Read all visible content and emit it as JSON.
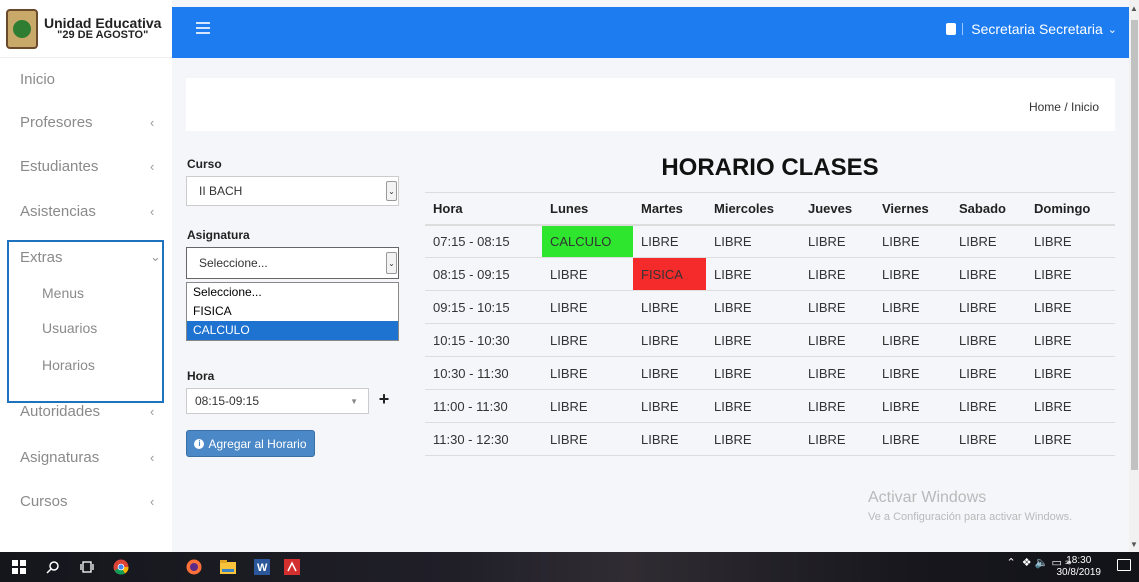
{
  "brand": {
    "line1": "Unidad Educativa",
    "line2": "\"29 DE AGOSTO\""
  },
  "sidebar": {
    "items": [
      {
        "label": "Inicio"
      },
      {
        "label": "Profesores"
      },
      {
        "label": "Estudiantes"
      },
      {
        "label": "Asistencias"
      },
      {
        "label": "Extras"
      },
      {
        "label": "Autoridades"
      },
      {
        "label": "Asignaturas"
      },
      {
        "label": "Cursos"
      }
    ],
    "subitems": [
      {
        "label": "Menus"
      },
      {
        "label": "Usuarios"
      },
      {
        "label": "Horarios"
      }
    ]
  },
  "topbar": {
    "user": "Secretaria Secretaria"
  },
  "breadcrumb": "Home / Inicio",
  "form": {
    "curso_label": "Curso",
    "curso_value": "II BACH",
    "asignatura_label": "Asignatura",
    "asignatura_value": "Seleccione...",
    "asignatura_options": [
      "Seleccione...",
      "FISICA",
      "CALCULO"
    ],
    "hora_label": "Hora",
    "hora_value": "08:15-09:15",
    "plus": "+",
    "add_button": "Agregar al Horario"
  },
  "schedule": {
    "title": "HORARIO CLASES",
    "headers": [
      "Hora",
      "Lunes",
      "Martes",
      "Miercoles",
      "Jueves",
      "Viernes",
      "Sabado",
      "Domingo"
    ],
    "rows": [
      [
        "07:15 - 08:15",
        "CALCULO",
        "LIBRE",
        "LIBRE",
        "LIBRE",
        "LIBRE",
        "LIBRE",
        "LIBRE"
      ],
      [
        "08:15 - 09:15",
        "LIBRE",
        "FISICA",
        "LIBRE",
        "LIBRE",
        "LIBRE",
        "LIBRE",
        "LIBRE"
      ],
      [
        "09:15 - 10:15",
        "LIBRE",
        "LIBRE",
        "LIBRE",
        "LIBRE",
        "LIBRE",
        "LIBRE",
        "LIBRE"
      ],
      [
        "10:15 - 10:30",
        "LIBRE",
        "LIBRE",
        "LIBRE",
        "LIBRE",
        "LIBRE",
        "LIBRE",
        "LIBRE"
      ],
      [
        "10:30 - 11:30",
        "LIBRE",
        "LIBRE",
        "LIBRE",
        "LIBRE",
        "LIBRE",
        "LIBRE",
        "LIBRE"
      ],
      [
        "11:00 - 11:30",
        "LIBRE",
        "LIBRE",
        "LIBRE",
        "LIBRE",
        "LIBRE",
        "LIBRE",
        "LIBRE"
      ],
      [
        "11:30 - 12:30",
        "LIBRE",
        "LIBRE",
        "LIBRE",
        "LIBRE",
        "LIBRE",
        "LIBRE",
        "LIBRE"
      ]
    ],
    "highlight_colors": {
      "green": "#2ee62e",
      "red": "#f52a2a"
    }
  },
  "watermark": {
    "line1": "Activar Windows",
    "line2": "Ve a Configuración para activar Windows."
  },
  "taskbar": {
    "time": "18:30",
    "date": "30/8/2019"
  },
  "colors": {
    "topbar": "#1c7cf0",
    "button": "#4a88c7",
    "selected_option": "#1e73d0"
  }
}
